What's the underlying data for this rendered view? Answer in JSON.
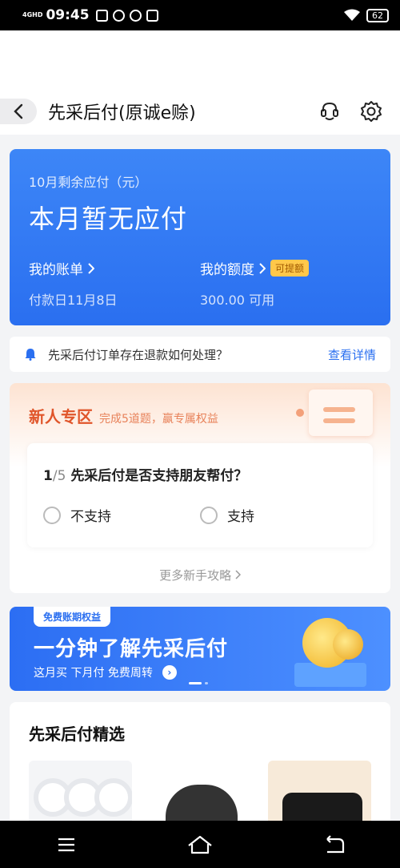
{
  "status_bar": {
    "network": "4GHD",
    "time": "09:45",
    "battery": "62"
  },
  "header": {
    "title": "先采后付(原诚e赊)"
  },
  "bill_card": {
    "label": "10月剩余应付（元）",
    "amount_text": "本月暂无应付",
    "my_bill": "我的账单",
    "pay_day": "付款日11月8日",
    "my_limit": "我的额度",
    "limit_tag": "可提额",
    "limit_value": "300.00 可用"
  },
  "notice": {
    "text": "先采后付订单存在退款如何处理？",
    "link": "查看详情"
  },
  "newbie": {
    "title": "新人专区",
    "subtitle": "完成5道题，赢专属权益",
    "question_current": "1",
    "question_total": "/5",
    "question": "先采后付是否支持朋友帮付？",
    "options": [
      "不支持",
      "支持"
    ],
    "more": "更多新手攻略"
  },
  "banner": {
    "tag": "免费账期权益",
    "headline": "一分钟了解先采后付",
    "sub": "这月买 下月付 免费周转"
  },
  "picks": {
    "title": "先采后付精选"
  }
}
